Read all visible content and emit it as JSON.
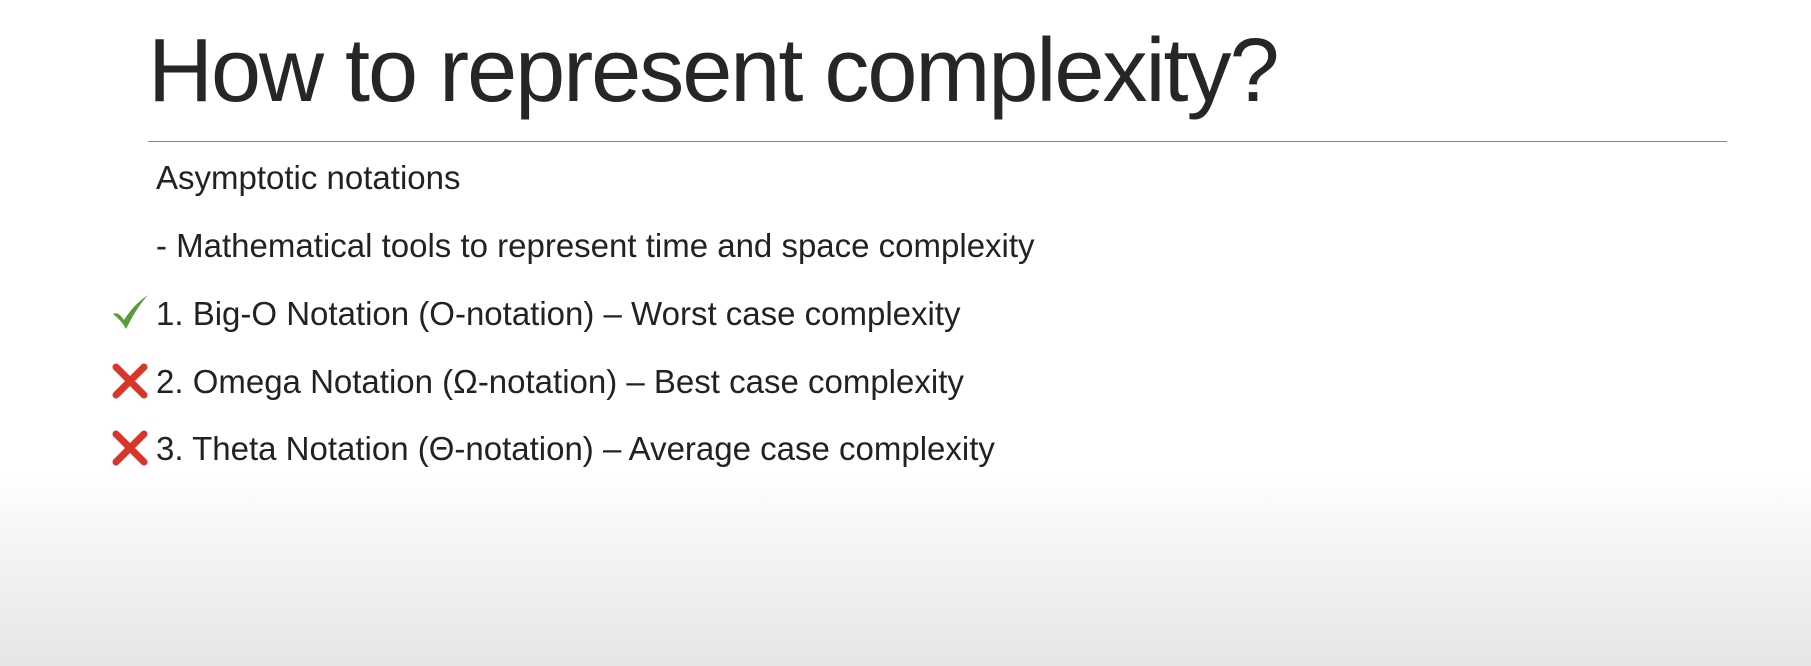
{
  "slide": {
    "title": "How to represent complexity?",
    "subtitle": "Asymptotic notations",
    "description": "- Mathematical tools to represent time and space complexity",
    "items": [
      {
        "text": "1. Big-O Notation (O-notation) – Worst case complexity",
        "status_icon": "checkmark-icon",
        "status_color": "#5a9a3a"
      },
      {
        "text": "2. Omega Notation (Ω-notation) – Best case complexity",
        "status_icon": "cross-icon",
        "status_color": "#d9352a"
      },
      {
        "text": "3. Theta Notation (Θ-notation) – Average case complexity",
        "status_icon": "cross-icon",
        "status_color": "#d9352a"
      }
    ]
  }
}
